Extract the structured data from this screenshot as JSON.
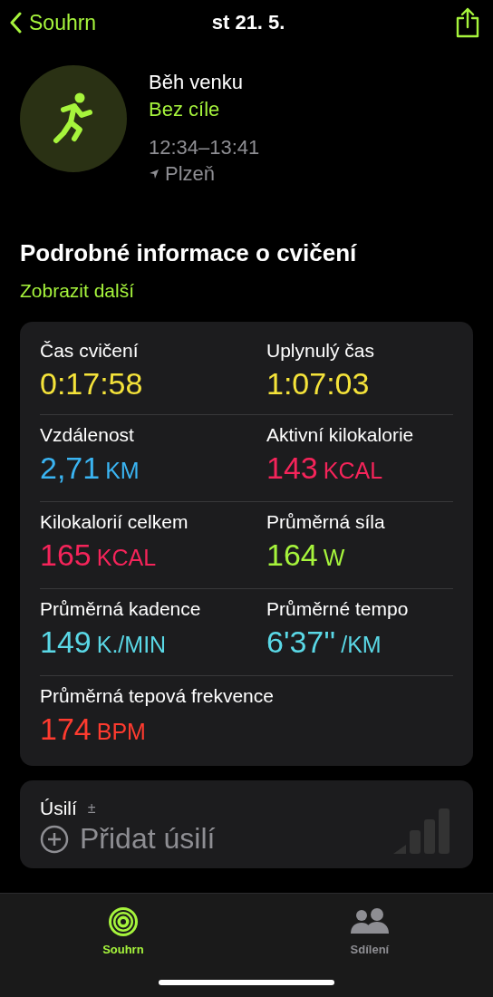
{
  "nav": {
    "back": "Souhrn",
    "title": "st 21. 5."
  },
  "workout": {
    "name": "Běh venku",
    "goal": "Bez cíle",
    "time": "12:34–13:41",
    "location": "Plzeň"
  },
  "section": {
    "title": "Podrobné informace o cvičení",
    "link": "Zobrazit další"
  },
  "metrics": [
    {
      "label": "Čas cvičení",
      "value": "0:17:58",
      "color": "#f5e33a"
    },
    {
      "label": "Uplynulý čas",
      "value": "1:07:03",
      "color": "#f5e33a"
    },
    {
      "label": "Vzdálenost",
      "value": "2,71",
      "unit": "KM",
      "color": "#3ab4f2"
    },
    {
      "label": "Aktivní kilokalorie",
      "value": "143",
      "unit": "KCAL",
      "color": "#f5245a"
    },
    {
      "label": "Kilokalorií celkem",
      "value": "165",
      "unit": "KCAL",
      "color": "#f5245a"
    },
    {
      "label": "Průměrná síla",
      "value": "164",
      "unit": "W",
      "color": "#a6f43c"
    },
    {
      "label": "Průměrná kadence",
      "value": "149",
      "unit": "K./MIN",
      "color": "#5ad8e6"
    },
    {
      "label": "Průměrné tempo",
      "value": "6'37''",
      "unit": "/KM",
      "color": "#5ad8e6"
    },
    {
      "label": "Průměrná tepová frekvence",
      "value": "174",
      "unit": "BPM",
      "color": "#ff3b2f"
    }
  ],
  "effort": {
    "title": "Úsilí",
    "symbol": "±",
    "add": "Přidat úsilí"
  },
  "tabs": [
    {
      "label": "Souhrn",
      "selected": true,
      "kind": "rings"
    },
    {
      "label": "Sdílení",
      "selected": false,
      "kind": "people"
    }
  ]
}
